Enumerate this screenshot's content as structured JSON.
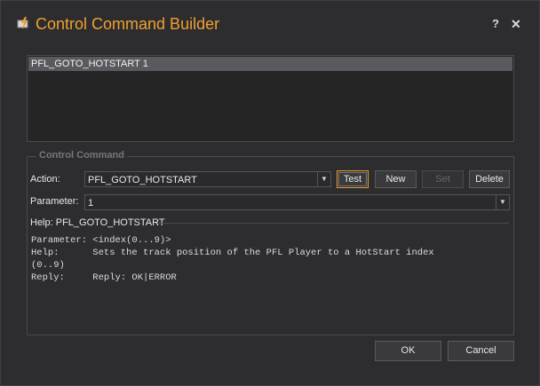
{
  "window": {
    "title": "Control Command Builder",
    "help_glyph": "?",
    "close_glyph": "✕",
    "accent_color": "#f0a030"
  },
  "command_list": {
    "items": [
      "PFL_GOTO_HOTSTART 1"
    ]
  },
  "control_command": {
    "group_label": "Control Command",
    "action_label": "Action:",
    "action_value": "PFL_GOTO_HOTSTART",
    "parameter_label": "Parameter:",
    "parameter_value": "1",
    "buttons": {
      "test": "Test",
      "new": "New",
      "set": "Set",
      "delete": "Delete"
    },
    "help_title": "Help: PFL_GOTO_HOTSTART",
    "help_lines": [
      "Parameter: <index(0...9)>",
      "Help:      Sets the track position of the PFL Player to a HotStart index",
      "(0..9)",
      "Reply:     Reply: OK|ERROR"
    ]
  },
  "footer": {
    "ok": "OK",
    "cancel": "Cancel"
  }
}
